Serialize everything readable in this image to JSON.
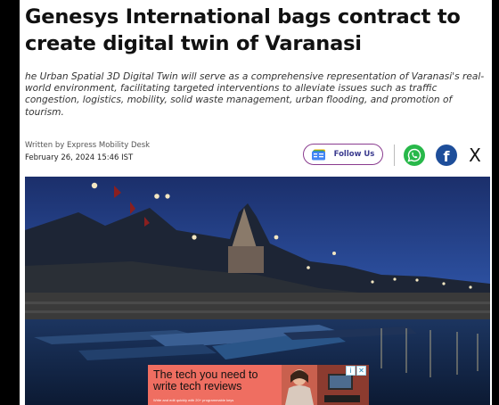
{
  "article": {
    "headline": "Genesys International bags contract to create digital twin of Varanasi",
    "summary": "he Urban Spatial 3D Digital Twin will serve as a comprehensive representation of Varanasi's real-world environment, facilitating targeted interventions to alleviate issues such as traffic congestion, logistics, mobility, solid waste management, urban flooding, and promotion of tourism.",
    "byline": "Written by Express Mobility Desk",
    "date": "February 26, 2024 15:46 IST"
  },
  "follow_button": {
    "label": "Follow Us",
    "icon": "google-news-icon"
  },
  "share": {
    "whatsapp_icon": "whatsapp-icon",
    "facebook_icon": "facebook-icon",
    "x_icon": "x-icon",
    "facebook_glyph": "f",
    "x_glyph": "X"
  },
  "ad": {
    "headline": "The tech you need to write tech reviews",
    "fine_print": "Write and edit quickly with 20+ programmable keys",
    "info_glyph": "i",
    "close_glyph": "✕"
  },
  "colors": {
    "follow_border": "#8a3c8f",
    "whatsapp": "#28b84a",
    "facebook": "#1e4e9a",
    "ad_background": "#ef6e61"
  }
}
